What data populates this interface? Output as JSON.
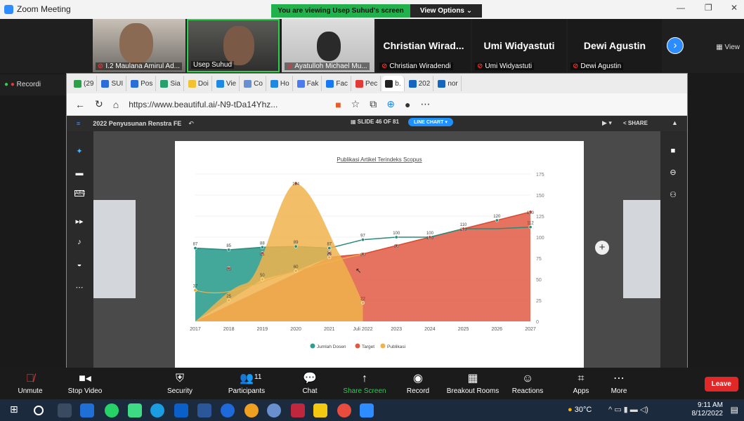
{
  "zoom": {
    "app_title": "Zoom Meeting",
    "banner_text": "You are viewing Usep Suhud's screen",
    "view_options": "View Options ⌄",
    "view_label": "View",
    "recording_label": "Recordi",
    "participants": [
      {
        "name": "I.2 Maulana Amirul Ad...",
        "muted": true
      },
      {
        "name": "Usep Suhud",
        "muted": false
      },
      {
        "name": "Ayatulloh Michael Mu...",
        "muted": true
      },
      {
        "title": "Christian Wirad...",
        "name": "Christian Wiradendi",
        "muted": true
      },
      {
        "title": "Umi Widyastuti",
        "name": "Umi Widyastuti",
        "muted": true
      },
      {
        "title": "Dewi Agustin",
        "name": "Dewi Agustin",
        "muted": true
      }
    ]
  },
  "browser": {
    "tabs": [
      "(29",
      "SUI",
      "Pos",
      "Sia",
      "Doi",
      "Vie",
      "Co",
      "Ho",
      "Fak",
      "Fac",
      "Pec",
      "b.",
      "202",
      "nor"
    ],
    "url": "https://www.beautiful.ai/-N9-tDa14Yhz..."
  },
  "app": {
    "project": "2022 Penyusunan Renstra FE",
    "slide": "SLIDE 46 OF 81",
    "chart_type_label": "LINE CHART",
    "share": "SHARE"
  },
  "chart_data": {
    "type": "area",
    "title": "Publikasi Artikel Terindeks Scopus",
    "categories": [
      "2017",
      "2018",
      "2019",
      "2020",
      "2021",
      "Juli 2022",
      "2023",
      "2024",
      "2025",
      "2026",
      "2027"
    ],
    "y_right_ticks": [
      "175",
      "150",
      "125",
      "100",
      "75",
      "50",
      "25",
      "0"
    ],
    "ylim": [
      0,
      175
    ],
    "series": [
      {
        "name": "Jumlah Dosen",
        "color": "#2f9e8f",
        "values": [
          87,
          85,
          88,
          89,
          87,
          null,
          null,
          null,
          null,
          null,
          null
        ]
      },
      {
        "name": "Target",
        "color": "#e05a43",
        "values": [
          null,
          null,
          null,
          null,
          76,
          80,
          90,
          100,
          110,
          120,
          130
        ]
      },
      {
        "name": "Publikasi",
        "color": "#f0b34c",
        "values": [
          0,
          25,
          50,
          60,
          76,
          22,
          null,
          null,
          null,
          null,
          null
        ]
      }
    ],
    "point_labels": {
      "jumlah_dosen": [
        [
          "87",
          0
        ],
        [
          "85",
          1
        ],
        [
          "88",
          2
        ],
        [
          "89",
          3
        ],
        [
          "87",
          4
        ],
        [
          "97",
          5
        ],
        [
          "100",
          6
        ],
        [
          "100",
          7
        ],
        [
          "110",
          8
        ],
        [
          "120",
          9
        ],
        [
          "112",
          10
        ]
      ],
      "publikasi": [
        [
          "37",
          0
        ],
        [
          "25",
          1
        ],
        [
          "50",
          2
        ],
        [
          "60",
          3
        ],
        [
          "76",
          4
        ],
        [
          "22",
          5
        ]
      ],
      "target": [
        [
          "63",
          1
        ],
        [
          "81",
          2
        ],
        [
          "164",
          3
        ],
        [
          "81",
          4
        ],
        [
          "80",
          5
        ],
        [
          "90",
          6
        ],
        [
          "100",
          7
        ],
        [
          "110",
          8
        ],
        [
          "130",
          10
        ]
      ]
    },
    "legend": [
      "Jumlah Dosen",
      "Target",
      "Publikasi"
    ],
    "legend_position": "bottom"
  },
  "controls": [
    "Unmute",
    "Stop Video",
    "Security",
    "Participants",
    "Chat",
    "Share Screen",
    "Record",
    "Breakout Rooms",
    "Reactions",
    "Apps",
    "More"
  ],
  "participants_count": "11",
  "leave": "Leave",
  "taskbar": {
    "weather": "30°C",
    "time": "9:11 AM",
    "date": "8/12/2022"
  }
}
